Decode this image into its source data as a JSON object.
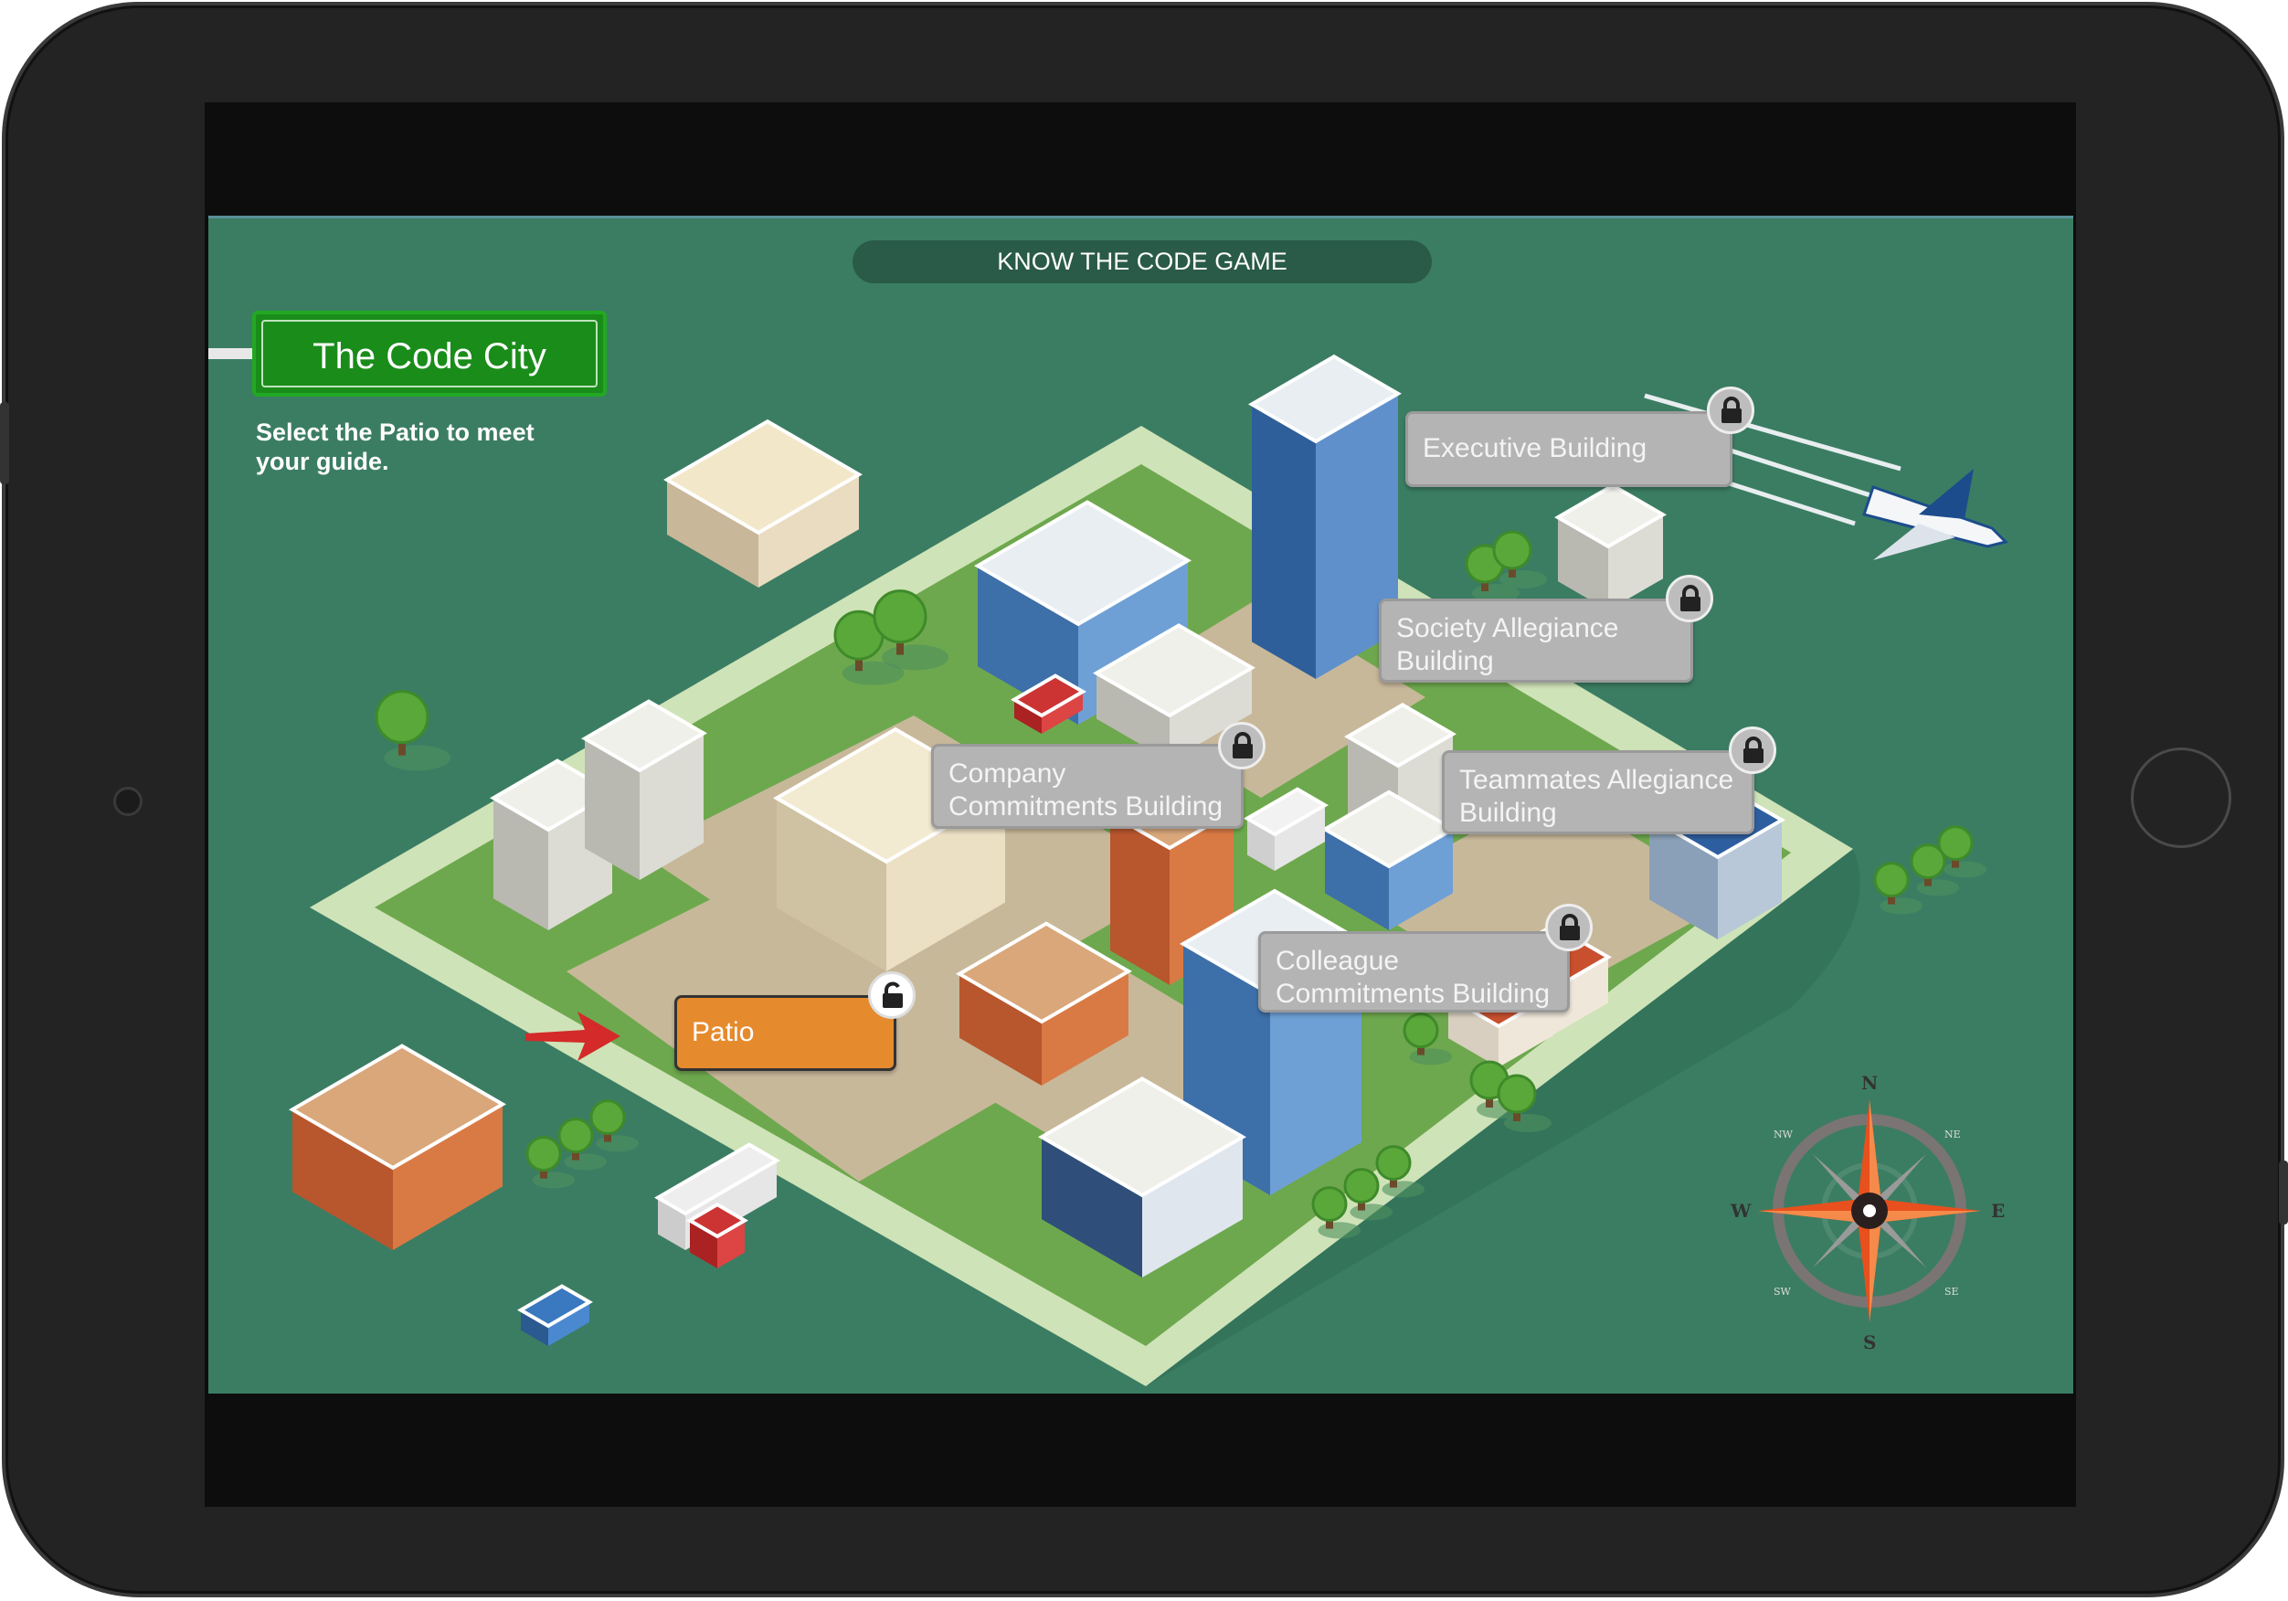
{
  "game": {
    "title": "KNOW THE CODE GAME",
    "city_name": "The Code City",
    "instruction": "Select the Patio to meet your guide."
  },
  "locations": [
    {
      "name": "Executive Building",
      "locked": true,
      "icon": "lock-icon"
    },
    {
      "name": "Society Allegiance Building",
      "locked": true,
      "icon": "lock-icon"
    },
    {
      "name": "Company Commitments Building",
      "locked": true,
      "icon": "lock-icon"
    },
    {
      "name": "Teammates Allegiance Building",
      "locked": true,
      "icon": "lock-icon"
    },
    {
      "name": "Colleague Commitments Building",
      "locked": true,
      "icon": "lock-icon"
    },
    {
      "name": "Patio",
      "locked": false,
      "icon": "unlock-icon",
      "highlighted": true
    }
  ],
  "compass": {
    "n": "N",
    "s": "S",
    "e": "E",
    "w": "W",
    "ne": "NE",
    "nw": "NW",
    "se": "SE",
    "sw": "SW"
  },
  "colors": {
    "background": "#3b7d63",
    "patio": "#e68a2e",
    "locked_label": "#b4b4b4",
    "city_button": "#1a8c1a",
    "arrow": "#d42a2a",
    "compass_star": "#e8501e"
  }
}
